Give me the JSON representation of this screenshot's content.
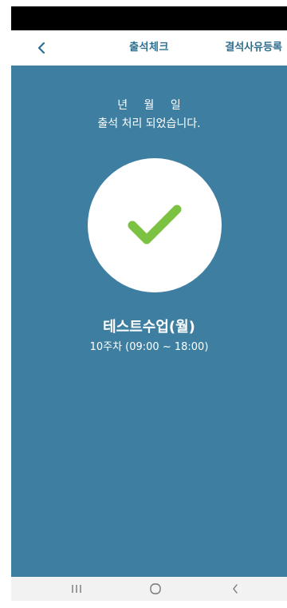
{
  "header": {
    "title": "출석체크",
    "absence_button": "결석사유등록",
    "back_icon": "chevron-left-icon"
  },
  "attendance": {
    "date_parts": [
      "년",
      "월",
      "일"
    ],
    "message": "출석 처리 되었습니다.",
    "check_icon": "checkmark-icon",
    "class_name": "테스트수업(월)",
    "class_time": "10주차 (09:00 ~ 18:00)"
  },
  "navbar": {
    "recent_icon": "recent-apps-icon",
    "home_icon": "home-icon",
    "back_icon": "back-icon"
  },
  "colors": {
    "brand_blue": "#3e7fa1",
    "header_text": "#2f6d8f",
    "check_green": "#7cc242"
  }
}
